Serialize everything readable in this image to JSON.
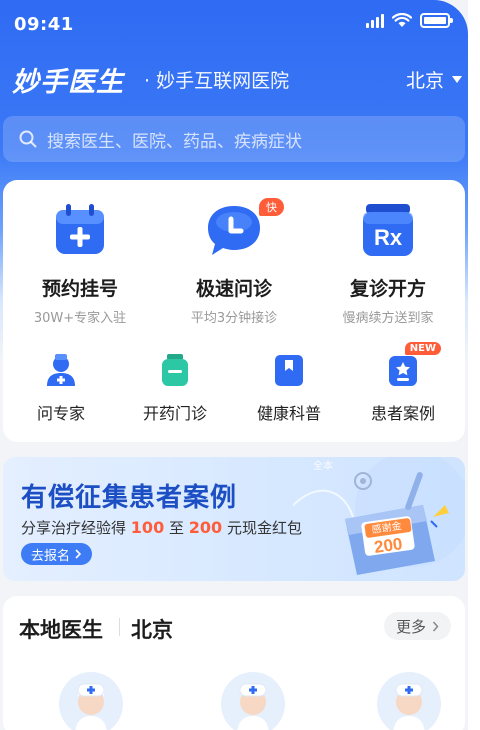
{
  "status": {
    "time": "09:41"
  },
  "header": {
    "logo": "妙手医生",
    "subtitle": "· 妙手互联网医院",
    "city": "北京"
  },
  "search": {
    "placeholder": "搜索医生、医院、药品、疾病症状"
  },
  "services": [
    {
      "title": "预约挂号",
      "desc": "30W+专家入驻",
      "icon": "calendar-plus-icon"
    },
    {
      "title": "极速问诊",
      "desc": "平均3分钟接诊",
      "icon": "chat-clock-icon",
      "badge": "快"
    },
    {
      "title": "复诊开方",
      "desc": "慢病续方送到家",
      "icon": "rx-icon"
    }
  ],
  "shortcuts": [
    {
      "label": "问专家",
      "icon": "doctor-icon"
    },
    {
      "label": "开药门诊",
      "icon": "medicine-bottle-icon"
    },
    {
      "label": "健康科普",
      "icon": "bookmark-book-icon"
    },
    {
      "label": "患者案例",
      "icon": "case-star-icon",
      "badge": "NEW"
    }
  ],
  "banner": {
    "title": "有偿征集患者案例",
    "sub_prefix": "分享治疗经验得",
    "amount1": "100",
    "sub_mid": "至",
    "amount2": "200",
    "sub_suffix": "元现金红包",
    "button": "去报名",
    "envelope_label": "感谢金",
    "envelope_amount": "200",
    "watermark": "全本"
  },
  "local": {
    "title": "本地医生",
    "city": "北京",
    "more": "更多"
  },
  "colors": {
    "primary": "#2f6bf3",
    "accent": "#ff5c39",
    "teal": "#2cc7a4"
  }
}
